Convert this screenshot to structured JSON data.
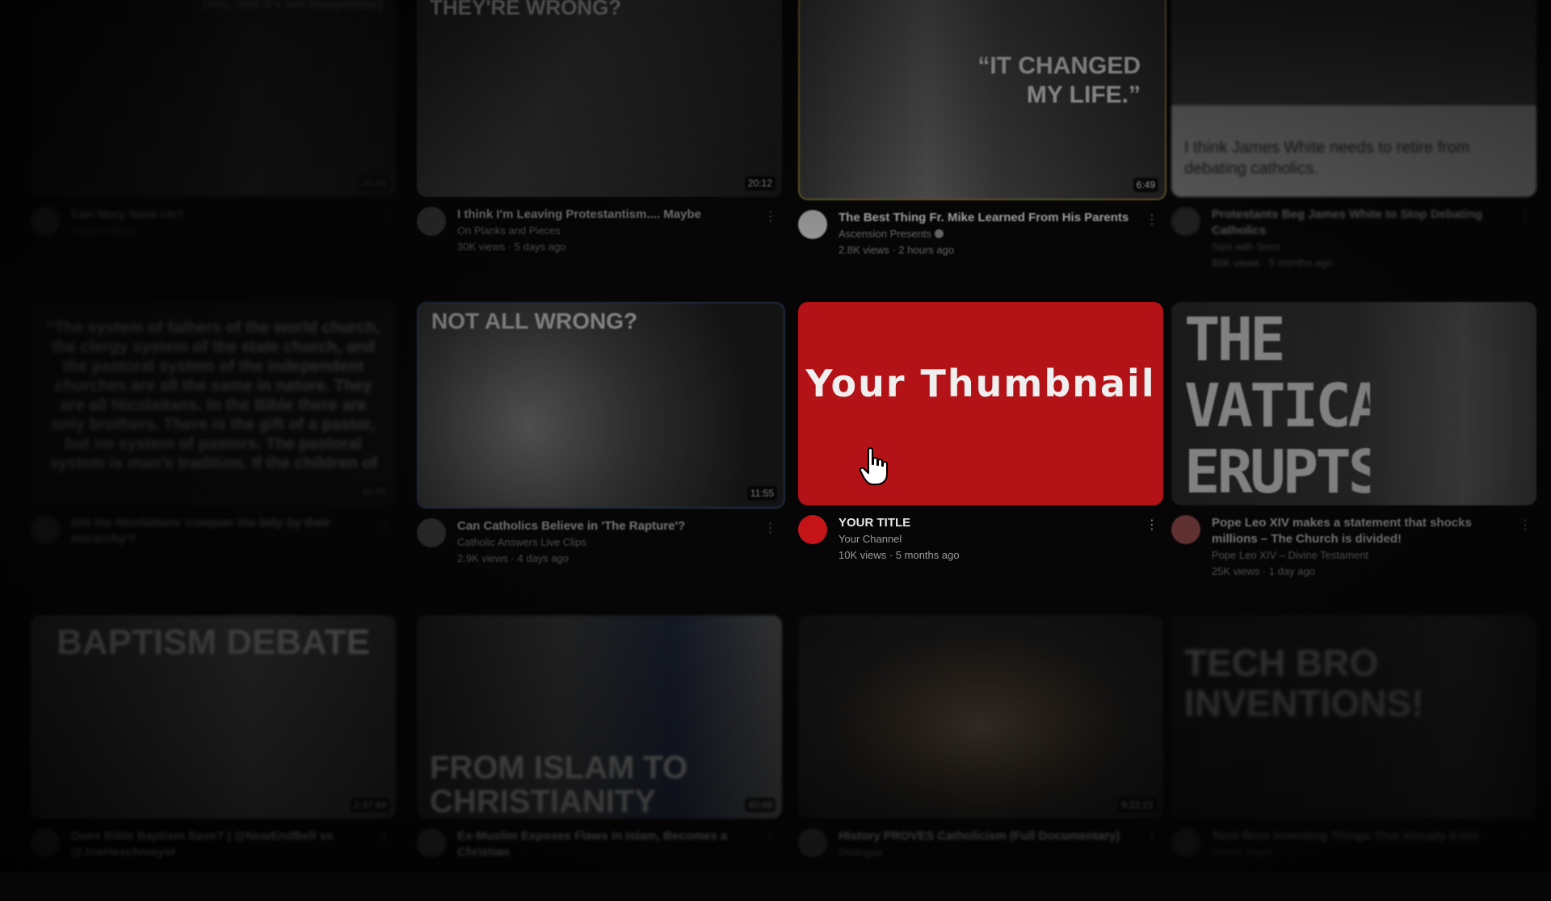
{
  "rows": [
    [
      {
        "title": "Can Mary Save Us?",
        "channel": "Gavin Ortlund",
        "stats": "",
        "duration": "22:35",
        "thumb_text": "(Yes, and it's not blasphemy.)"
      },
      {
        "title": "I think I'm Leaving Protestantism.... Maybe",
        "channel": "On Planks and Pieces",
        "stats": "30K views · 5 days ago",
        "duration": "20:12",
        "thumb_text": "THEY'RE WRONG?"
      },
      {
        "title": "The Best Thing Fr. Mike Learned From His Parents",
        "channel": "Ascension Presents",
        "stats": "2.8K views · 2 hours ago",
        "duration": "6:49",
        "thumb_text": "“IT CHANGED MY LIFE.”"
      },
      {
        "title": "Protestants Beg James White to Stop Debating Catholics",
        "channel": "Sips with Sens",
        "stats": "86K views · 5 months ago",
        "duration": "",
        "thumb_text": "I think James White needs to retire from debating catholics."
      }
    ],
    [
      {
        "title": "Did the Nicolaitans 'conquer the laity by their hierarchy'?",
        "channel": "",
        "stats": "",
        "duration": "20:25",
        "thumb_text": "“The system of fathers of the world church, the clergy system of the state church, and the pastoral system of the independent churches are all the same in nature. They are all Nicolaitans. In the Bible there are only brothers. There is the gift of a pastor, but no system of pastors. The pastoral system is man's tradition. If the children of"
      },
      {
        "title": "Can Catholics Believe in 'The Rapture'?",
        "channel": "Catholic Answers Live Clips",
        "stats": "2.9K views · 4 days ago",
        "duration": "11:55",
        "thumb_text": "NOT ALL WRONG?"
      },
      {
        "title": "YOUR TITLE",
        "channel": "Your Channel",
        "stats": "10K views · 5 months ago",
        "duration": "",
        "thumb_text": "Your Thumbnail"
      },
      {
        "title": "Pope Leo XIV makes a statement that shocks millions – The Church is divided!",
        "channel": "Pope Leo XIV – Divine Testament",
        "stats": "25K views · 1 day ago",
        "duration": "",
        "thumb_text": "THE VATICAN ERUPTS..."
      }
    ],
    [
      {
        "title": "Does Bible Baptism Save? | @NewEndBelt vs @JoeHeschmeyer",
        "channel": "",
        "stats": "",
        "duration": "2:37:49",
        "thumb_text": "BAPTISM DEBATE"
      },
      {
        "title": "Ex-Muslim Exposes Flaws in Islam, Becomes a Christian",
        "channel": "",
        "stats": "",
        "duration": "40:48",
        "thumb_text": "FROM ISLAM TO CHRISTIANITY"
      },
      {
        "title": "History PROVES Catholicism (Full Documentary)",
        "channel": "Distinguo",
        "stats": "",
        "duration": "9:22:21",
        "thumb_text": ""
      },
      {
        "title": "Tech Bros Inventing Things That Already Exist",
        "channel": "Patrick Boyle",
        "stats": "",
        "duration": "",
        "thumb_text": "TECH BRO INVENTIONS!"
      }
    ]
  ],
  "menu_icon": "kebab-menu-icon",
  "accent": "#b31216"
}
